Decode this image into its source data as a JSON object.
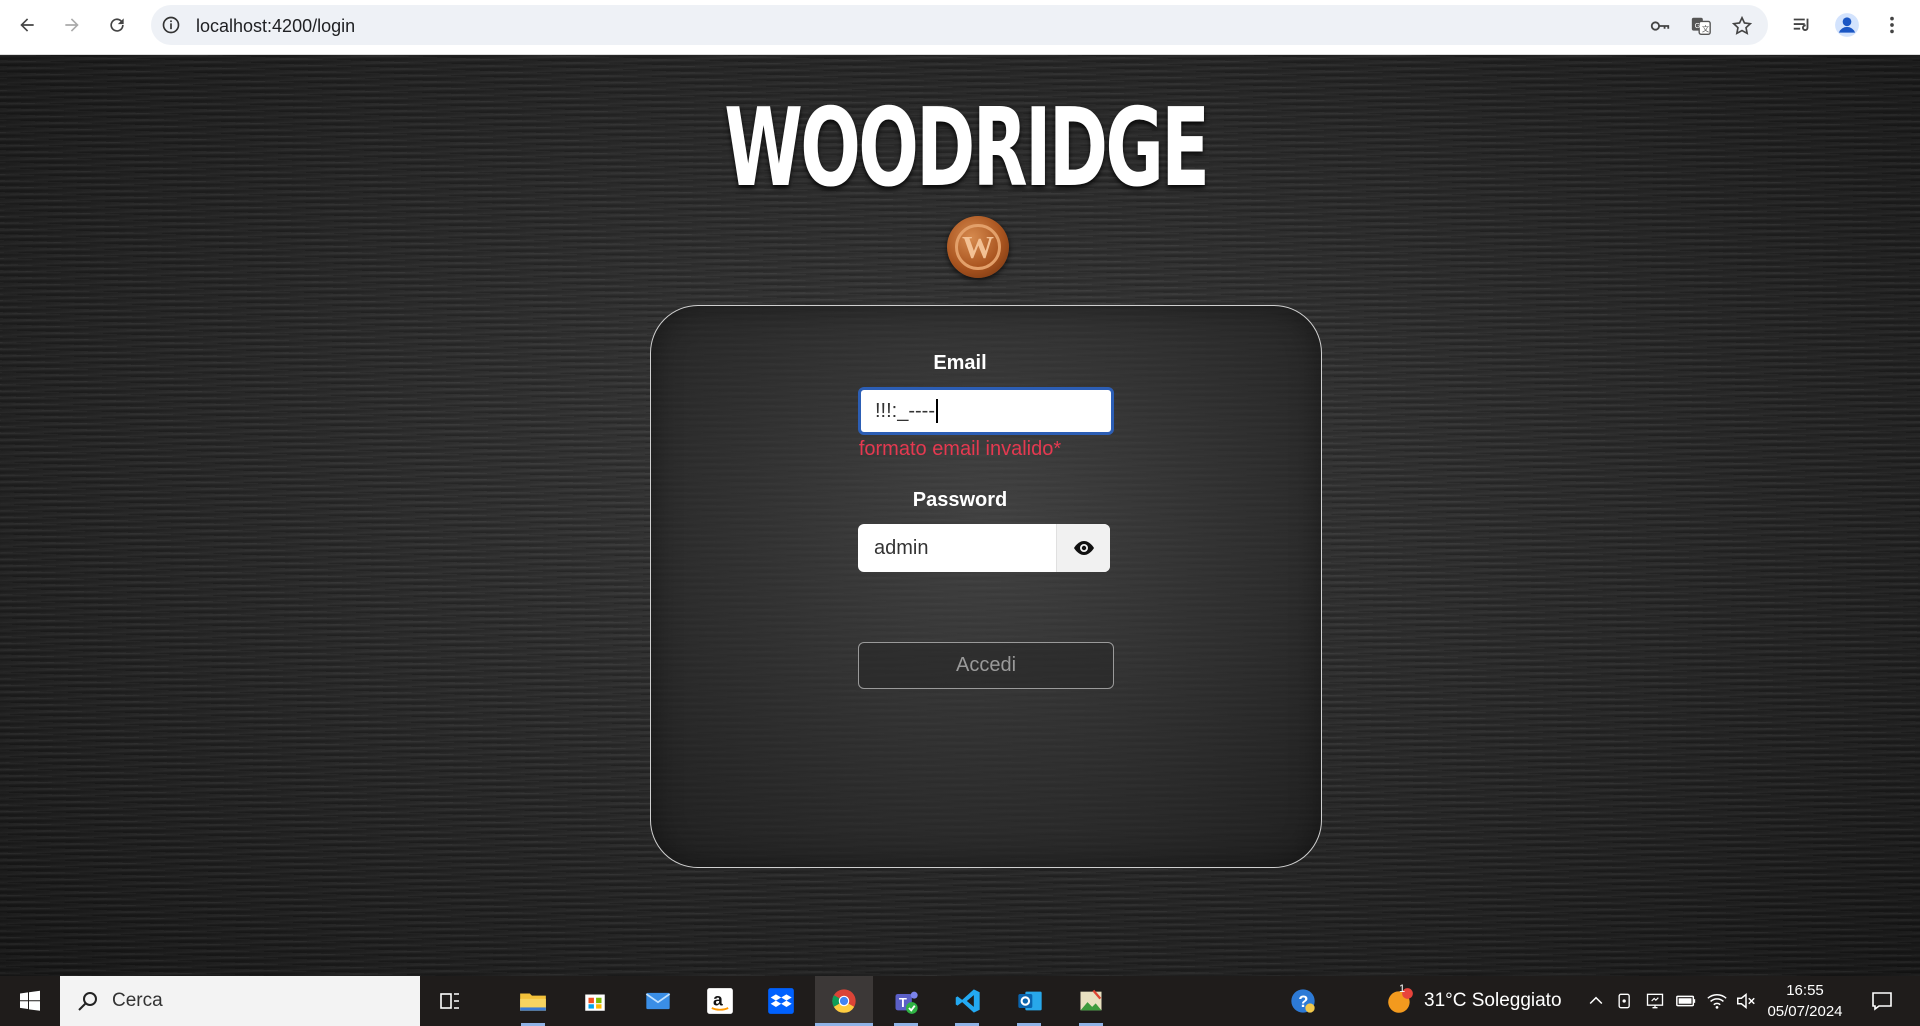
{
  "browser": {
    "url": "localhost:4200/login",
    "icons": [
      "back-icon",
      "forward-icon",
      "reload-icon",
      "site-info-icon",
      "key-icon",
      "translate-icon",
      "star-icon",
      "reading-list-icon",
      "profile-icon",
      "menu-icon"
    ]
  },
  "page": {
    "brand": "WOODRIDGE",
    "logo_letter": "W",
    "email_label": "Email",
    "email_value": "!!!:_----",
    "email_error": "formato email invalido*",
    "password_label": "Password",
    "password_value": "admin",
    "submit_label": "Accedi",
    "colors": {
      "error": "#e53950",
      "focus_border": "#2c5eb5"
    }
  },
  "taskbar": {
    "search_placeholder": "Cerca",
    "weather": "31°C  Soleggiato",
    "weather_badge": "1",
    "time": "16:55",
    "date": "05/07/2024"
  }
}
